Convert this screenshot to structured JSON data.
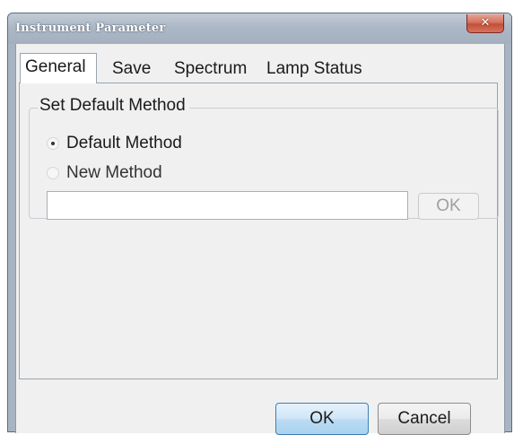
{
  "window": {
    "title": "Instrument Parameter",
    "close_label": "✕"
  },
  "tabs": [
    {
      "label": "General",
      "active": true
    },
    {
      "label": "Save",
      "active": false
    },
    {
      "label": "Spectrum",
      "active": false
    },
    {
      "label": "Lamp Status",
      "active": false
    }
  ],
  "general": {
    "group_title": "Set Default Method",
    "options": [
      {
        "label": "Default Method",
        "selected": true
      },
      {
        "label": "New Method",
        "selected": false
      }
    ],
    "method_input_value": "",
    "inner_ok_label": "OK"
  },
  "footer": {
    "ok_label": "OK",
    "cancel_label": "Cancel"
  }
}
